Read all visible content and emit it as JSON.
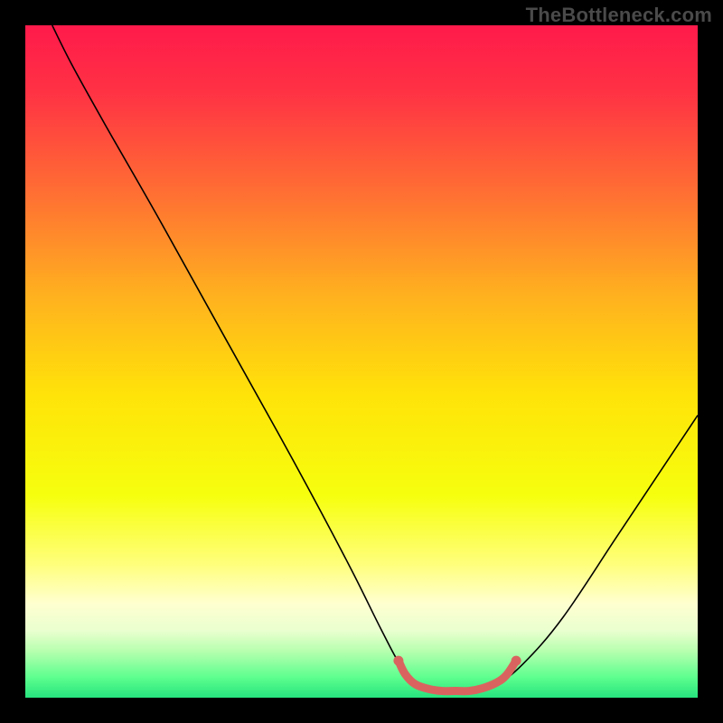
{
  "watermark": "TheBottleneck.com",
  "chart_data": {
    "type": "line",
    "title": "",
    "xlabel": "",
    "ylabel": "",
    "xlim": [
      0,
      100
    ],
    "ylim": [
      0,
      100
    ],
    "background_gradient": {
      "stops": [
        {
          "offset": 0.0,
          "color": "#ff1a4b"
        },
        {
          "offset": 0.1,
          "color": "#ff3244"
        },
        {
          "offset": 0.25,
          "color": "#ff6f33"
        },
        {
          "offset": 0.4,
          "color": "#ffb01f"
        },
        {
          "offset": 0.55,
          "color": "#ffe309"
        },
        {
          "offset": 0.7,
          "color": "#f6ff0e"
        },
        {
          "offset": 0.8,
          "color": "#ffff7a"
        },
        {
          "offset": 0.86,
          "color": "#ffffd0"
        },
        {
          "offset": 0.9,
          "color": "#eaffcf"
        },
        {
          "offset": 0.93,
          "color": "#b8ffb0"
        },
        {
          "offset": 0.97,
          "color": "#5dff8e"
        },
        {
          "offset": 1.0,
          "color": "#26e37e"
        }
      ]
    },
    "series": [
      {
        "name": "bottleneck-curve",
        "color": "#000000",
        "width": 1.6,
        "points": [
          {
            "x": 4.0,
            "y": 100.0
          },
          {
            "x": 7.0,
            "y": 94.0
          },
          {
            "x": 12.0,
            "y": 85.0
          },
          {
            "x": 20.0,
            "y": 71.0
          },
          {
            "x": 30.0,
            "y": 53.0
          },
          {
            "x": 40.0,
            "y": 35.0
          },
          {
            "x": 48.0,
            "y": 20.0
          },
          {
            "x": 53.0,
            "y": 10.0
          },
          {
            "x": 56.0,
            "y": 4.5
          },
          {
            "x": 58.5,
            "y": 2.0
          },
          {
            "x": 62.0,
            "y": 1.0
          },
          {
            "x": 66.0,
            "y": 1.0
          },
          {
            "x": 70.0,
            "y": 2.0
          },
          {
            "x": 74.0,
            "y": 5.0
          },
          {
            "x": 80.0,
            "y": 12.0
          },
          {
            "x": 88.0,
            "y": 24.0
          },
          {
            "x": 96.0,
            "y": 36.0
          },
          {
            "x": 100.0,
            "y": 42.0
          }
        ]
      }
    ],
    "highlight": {
      "color": "#d9645f",
      "width": 9,
      "cap_radius": 5.5,
      "points": [
        {
          "x": 55.5,
          "y": 5.5
        },
        {
          "x": 56.5,
          "y": 3.5
        },
        {
          "x": 58.0,
          "y": 2.0
        },
        {
          "x": 60.0,
          "y": 1.3
        },
        {
          "x": 62.0,
          "y": 1.0
        },
        {
          "x": 64.0,
          "y": 1.0
        },
        {
          "x": 66.0,
          "y": 1.0
        },
        {
          "x": 68.0,
          "y": 1.4
        },
        {
          "x": 70.0,
          "y": 2.2
        },
        {
          "x": 71.5,
          "y": 3.3
        },
        {
          "x": 73.0,
          "y": 5.5
        }
      ]
    }
  }
}
